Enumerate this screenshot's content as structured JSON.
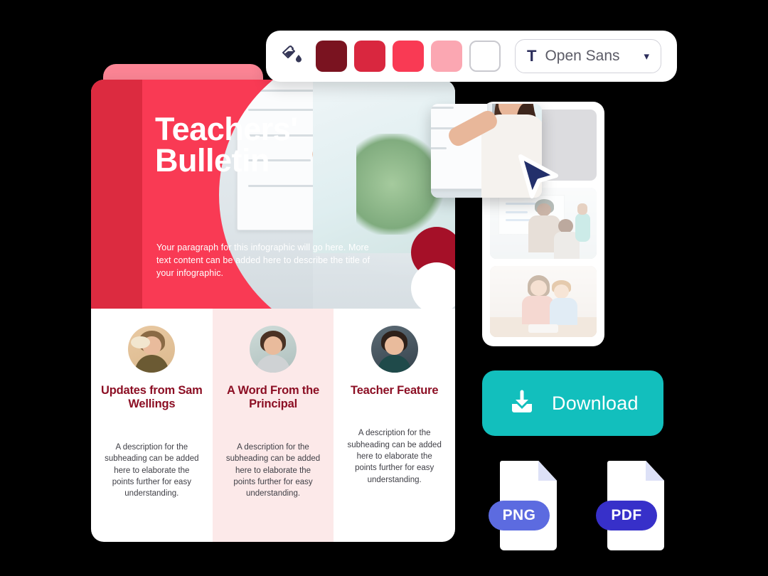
{
  "toolbar": {
    "bucket_icon": "paint-bucket-icon",
    "swatches": [
      {
        "name": "swatch-dark-maroon",
        "color": "#7A1320"
      },
      {
        "name": "swatch-crimson",
        "color": "#D9273F"
      },
      {
        "name": "swatch-red",
        "color": "#F93A54"
      },
      {
        "name": "swatch-light-pink",
        "color": "#FBA7B2"
      },
      {
        "name": "swatch-white",
        "color": "#FFFFFF"
      }
    ],
    "font_icon": "T",
    "font_name": "Open Sans",
    "chevron_icon": "chevron-down-icon"
  },
  "poster": {
    "title_line_1": "Teachers'",
    "title_line_2": "Bulletin",
    "paragraph": "Your paragraph for this infographic will go here. More text content can be added here to describe the title of your infographic.",
    "hero_color": "#F93A54",
    "hero_strip_color": "#DC2B40",
    "accent_dark_circle": "#A51028",
    "columns": [
      {
        "avatar": "avatar-sam-wellings",
        "title": "Updates from Sam Wellings",
        "body": "A description for the subheading can be added here to elaborate the points further for easy understanding."
      },
      {
        "avatar": "avatar-principal",
        "title": "A Word From the Principal",
        "body": "A description for the subheading can be added here to elaborate the points further for easy understanding."
      },
      {
        "avatar": "avatar-teacher-feature",
        "title": "Teacher Feature",
        "body": "A description for the subheading can be added here to elaborate the points further for easy understanding."
      }
    ],
    "column_title_color": "#8C0F24",
    "middle_column_bg": "#FCE9E9"
  },
  "image_panel": {
    "thumbnails": [
      {
        "name": "thumbnail-slot-empty",
        "label": ""
      },
      {
        "name": "thumbnail-classroom-raised-hand",
        "label": ""
      },
      {
        "name": "thumbnail-teacher-student-desk",
        "label": ""
      }
    ],
    "dragged_thumbnail": "thumbnail-teacher-whiteboard",
    "cursor": "cursor-arrow-icon"
  },
  "download": {
    "icon": "download-icon",
    "label": "Download",
    "color": "#12BFBD"
  },
  "files": [
    {
      "name": "file-badge-png",
      "label": "PNG",
      "color": "#5C6BE0"
    },
    {
      "name": "file-badge-pdf",
      "label": "PDF",
      "color": "#3730C9"
    }
  ]
}
